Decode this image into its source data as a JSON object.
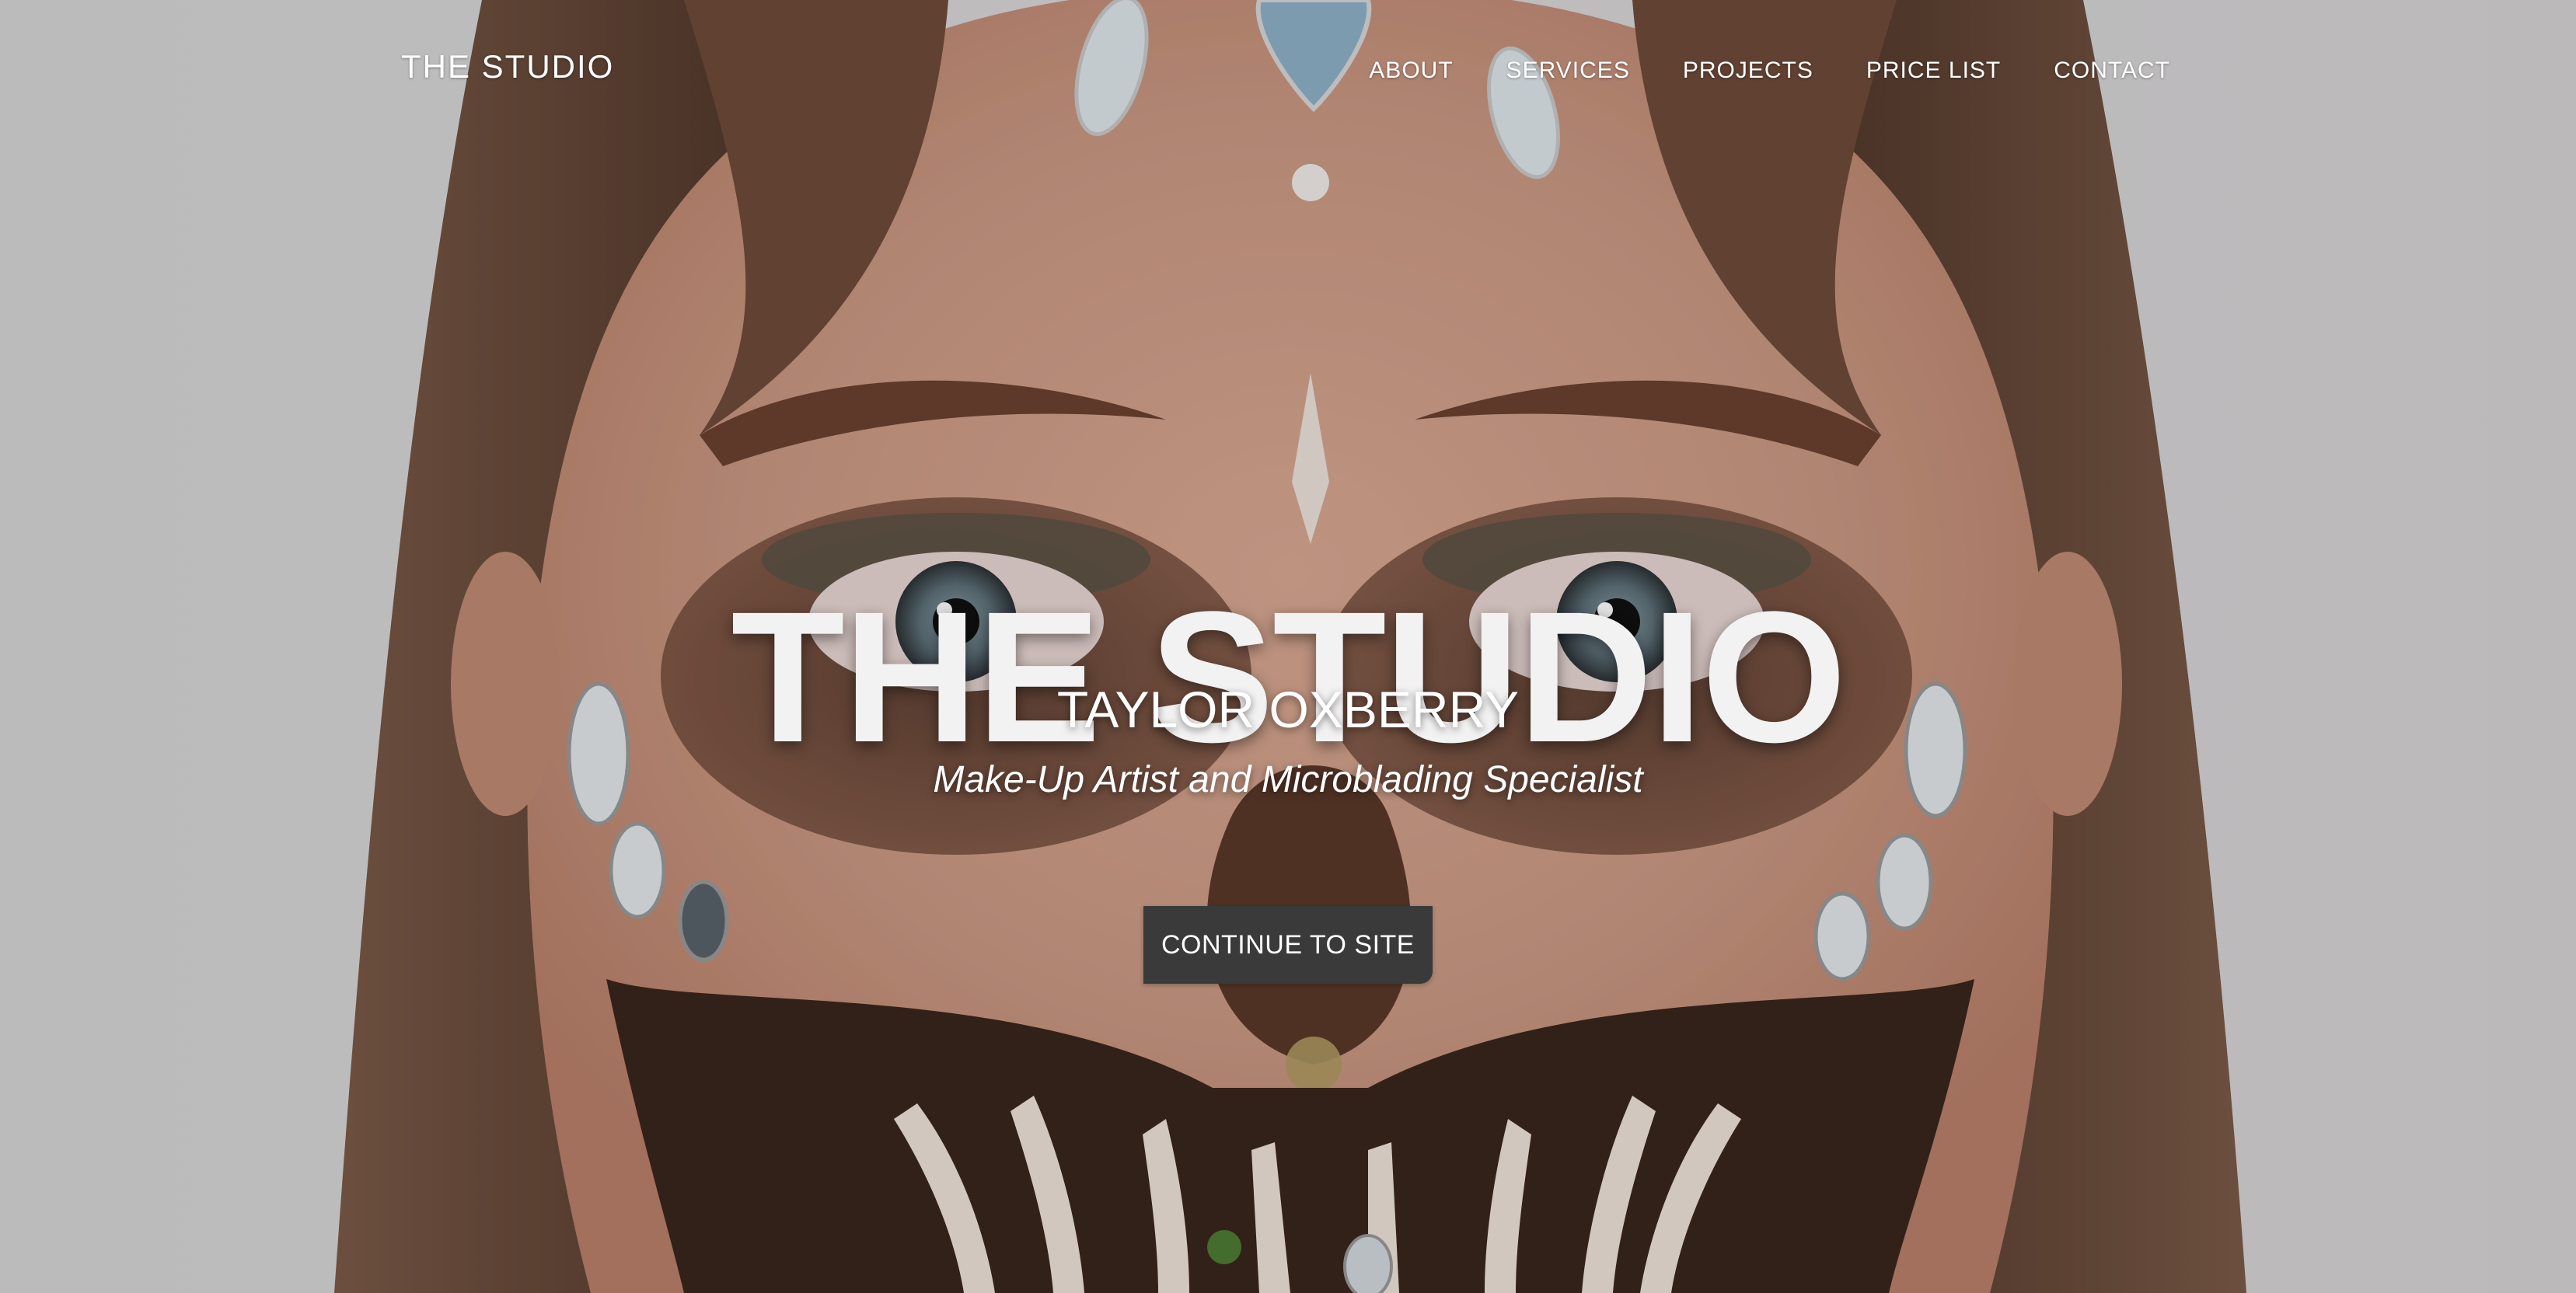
{
  "nav": {
    "brand": "THE STUDIO",
    "links": [
      "ABOUT",
      "SERVICES",
      "PROJECTS",
      "PRICE LIST",
      "CONTACT"
    ]
  },
  "hero": {
    "title": "THE STUDIO",
    "name": "TAYLOR OXBERRY",
    "tagline": "Make-Up Artist and Microblading Specialist",
    "cta_label": "CONTINUE TO SITE",
    "background_image": "skull-makeup-portrait",
    "cta_color": "#3a3a3a"
  }
}
